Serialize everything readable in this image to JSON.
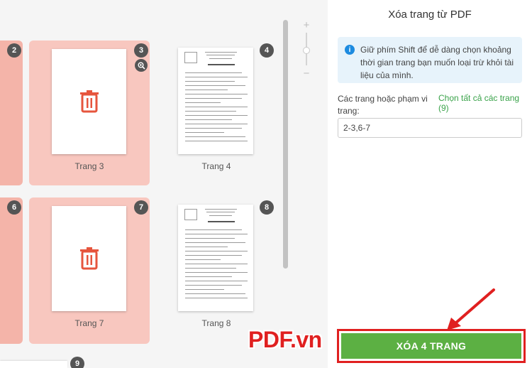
{
  "panel": {
    "title": "Xóa trang từ PDF",
    "info_text": "Giữ phím Shift để dễ dàng chọn khoảng thời gian trang bạn muốn loại trừ khỏi tài liệu của mình.",
    "range_label": "Các trang hoặc phạm vi trang:",
    "select_all_label": "Chọn tất cả các trang (9)",
    "range_value": "2-3,6-7",
    "delete_label": "XÓA 4 TRANG"
  },
  "pages": [
    {
      "number": "2",
      "label": "",
      "selected": true
    },
    {
      "number": "3",
      "label": "Trang 3",
      "selected": true
    },
    {
      "number": "4",
      "label": "Trang 4",
      "selected": false
    },
    {
      "number": "6",
      "label": "",
      "selected": true
    },
    {
      "number": "7",
      "label": "Trang 7",
      "selected": true
    },
    {
      "number": "8",
      "label": "Trang 8",
      "selected": false
    },
    {
      "number": "9",
      "label": "",
      "selected": false
    }
  ],
  "zoom": {
    "plus": "+",
    "minus": "−"
  },
  "watermark": "PDF.vn",
  "colors": {
    "accent_green": "#5cb043",
    "selected_tile": "#f8c7bf",
    "trash_red": "#e6553d",
    "highlight_red": "#e02020",
    "info_blue": "#1d8be0"
  }
}
